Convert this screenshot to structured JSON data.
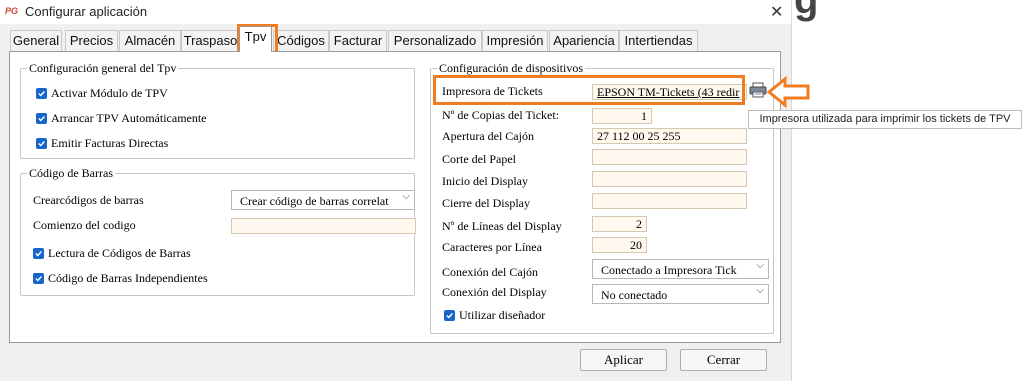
{
  "window": {
    "title": "Configurar aplicación",
    "app_icon": "PG",
    "close_glyph": "✕"
  },
  "tabs": [
    "General",
    "Precios",
    "Almacén",
    "Traspaso",
    "Tpv",
    "Códigos",
    "Facturar",
    "Personalizado",
    "Impresión",
    "Apariencia",
    "Intertiendas"
  ],
  "active_tab": "Tpv",
  "general": {
    "legend": "Configuración general del Tpv",
    "checks": [
      "Activar Módulo de TPV",
      "Arrancar TPV Automáticamente",
      "Emitir Facturas Directas"
    ]
  },
  "barcodes": {
    "legend": "Código de Barras",
    "create_label": "Crearcódigos de barras",
    "create_value": "Crear código de barras correlat",
    "start_label": "Comienzo del codigo",
    "start_value": "",
    "checks": [
      "Lectura de Códigos de Barras",
      "Código de Barras Independientes"
    ]
  },
  "devices": {
    "legend": "Configuración de dispositivos",
    "printer_label": "Impresora de Tickets",
    "printer_value": "EPSON TM-Tickets (43 redir",
    "copies_label": "Nº de Copias del Ticket:",
    "copies_value": "1",
    "drawer_label": "Apertura del Cajón",
    "drawer_value": "27 112 00 25 255",
    "cut_label": "Corte del Papel",
    "cut_value": "",
    "display_start_label": "Inicio del Display",
    "display_start_value": "",
    "display_close_label": "Cierre del Display",
    "display_close_value": "",
    "lines_label": "Nº de Líneas del Display",
    "lines_value": "2",
    "chars_label": "Caracteres por Línea",
    "chars_value": "20",
    "drawer_conn_label": "Conexión del Cajón",
    "drawer_conn_value": "Conectado a Impresora Tick",
    "display_conn_label": "Conexión del Display",
    "display_conn_value": "No conectado",
    "designer_label": "Utilizar diseñador"
  },
  "buttons": {
    "apply": "Aplicar",
    "close": "Cerrar"
  },
  "tooltip": "Impresora utilizada para imprimir los tickets de TPV",
  "background_glyph": "g",
  "colors": {
    "accent_orange": "#f07c22",
    "checkbox_blue": "#1667c9",
    "input_bg": "#fff8ef"
  },
  "icons": [
    "printer-icon",
    "arrow-up-annotation",
    "arrow-left-annotation",
    "checkmark-icon",
    "chevron-down-icon"
  ]
}
